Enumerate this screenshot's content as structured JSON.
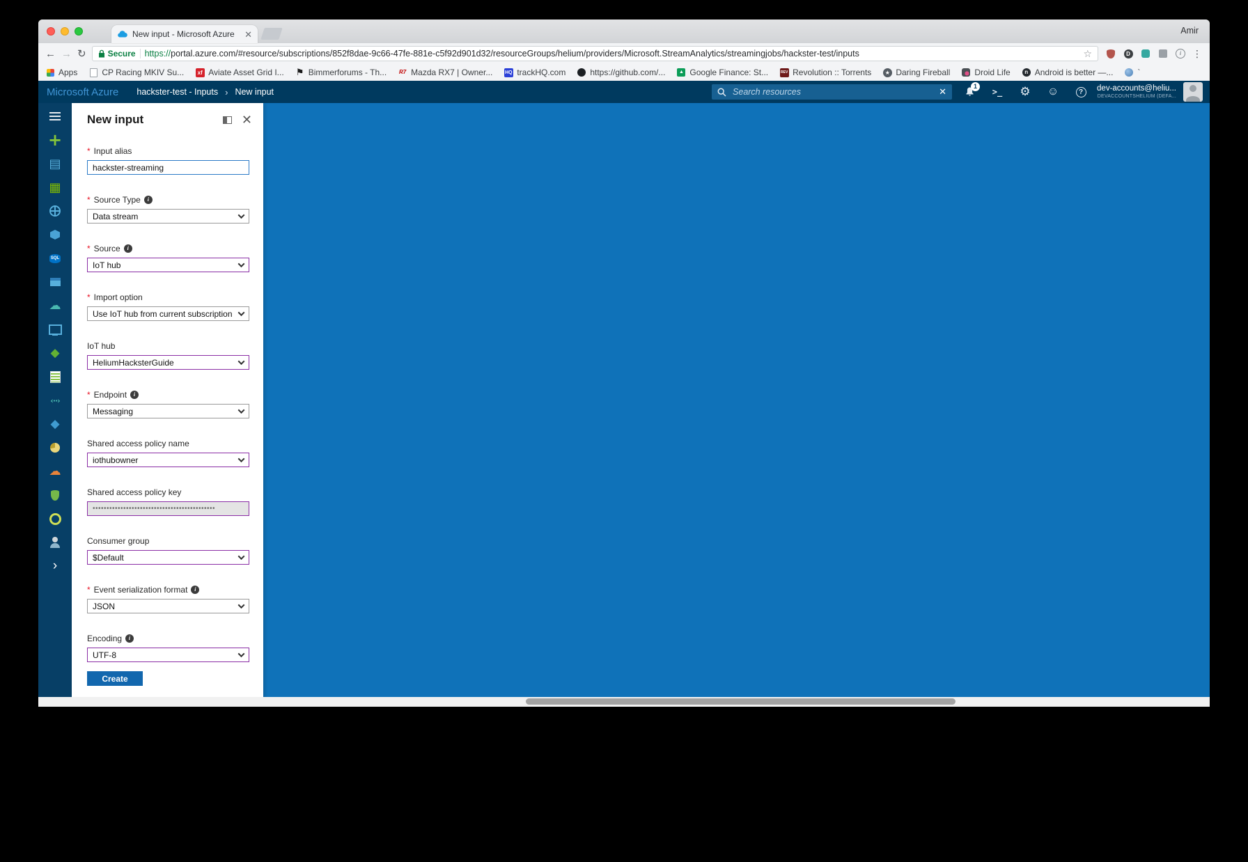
{
  "browser": {
    "profile_name": "Amir",
    "tab_title": "New input - Microsoft Azure",
    "address": {
      "security_label": "Secure",
      "url_scheme": "https://",
      "url_rest": "portal.azure.com/#resource/subscriptions/852f8dae-9c66-47fe-881e-c5f92d901d32/resourceGroups/helium/providers/Microsoft.StreamAnalytics/streamingjobs/hackster-test/inputs"
    },
    "extensions": [
      {
        "name": "extension-icon-1",
        "kind": "ext1"
      },
      {
        "name": "extension-icon-2",
        "kind": "ext2"
      },
      {
        "name": "extension-icon-3",
        "kind": "ext3"
      },
      {
        "name": "extension-icon-4",
        "kind": "ext4"
      },
      {
        "name": "extension-icon-5",
        "kind": "ext5"
      }
    ],
    "bookmarks": [
      {
        "name": "bookmark-apps",
        "kind": "apps",
        "label": "Apps"
      },
      {
        "name": "bookmark-cp-racing",
        "kind": "page",
        "label": "CP Racing MKIV Su..."
      },
      {
        "name": "bookmark-aviate",
        "kind": "xf",
        "label": "Aviate Asset Grid I..."
      },
      {
        "name": "bookmark-bimmerforums",
        "kind": "flag",
        "label": "Bimmerforums - Th..."
      },
      {
        "name": "bookmark-mazda-rx7",
        "kind": "rx7",
        "label": "Mazda RX7 | Owner..."
      },
      {
        "name": "bookmark-trackhq",
        "kind": "hq",
        "label": "trackHQ.com"
      },
      {
        "name": "bookmark-github",
        "kind": "github",
        "label": "https://github.com/..."
      },
      {
        "name": "bookmark-google-finance",
        "kind": "finance",
        "label": "Google Finance: St..."
      },
      {
        "name": "bookmark-revolution",
        "kind": "rev",
        "label": "Revolution :: Torrents"
      },
      {
        "name": "bookmark-daring-fireball",
        "kind": "star",
        "label": "Daring Fireball"
      },
      {
        "name": "bookmark-droid-life",
        "kind": "droid",
        "label": "Droid Life"
      },
      {
        "name": "bookmark-android-is-better",
        "kind": "dot",
        "label": "Android is better —..."
      },
      {
        "name": "bookmark-misc",
        "kind": "globe2",
        "label": "`"
      }
    ]
  },
  "azure": {
    "header": {
      "brand": "Microsoft Azure",
      "breadcrumb_primary": "hackster-test - Inputs",
      "breadcrumb_separator": "›",
      "breadcrumb_current": "New input",
      "search_placeholder": "Search resources",
      "notification_count": "1",
      "account": {
        "email": "dev-accounts@heliu...",
        "directory": "DEVACCOUNTSHELIUM (DEFA..."
      }
    },
    "sidebar": [
      {
        "item": "sidebar-item-menu",
        "icon": "hamburger-menu-icon",
        "kind": "hamburger"
      },
      {
        "item": "sidebar-item-new",
        "icon": "plus-icon",
        "kind": "plus"
      },
      {
        "item": "sidebar-item-dashboard",
        "icon": "dashboard-icon",
        "kind": "dashboard"
      },
      {
        "item": "sidebar-item-all-resources",
        "icon": "all-resources-grid-icon",
        "kind": "grid"
      },
      {
        "item": "sidebar-item-resource-groups",
        "icon": "globe-icon",
        "kind": "globe"
      },
      {
        "item": "sidebar-item-app-services",
        "icon": "cube-icon",
        "kind": "cube"
      },
      {
        "item": "sidebar-item-sql-databases",
        "icon": "sql-database-icon",
        "kind": "sql"
      },
      {
        "item": "sidebar-item-virtual-machines",
        "icon": "virtual-machine-icon",
        "kind": "vm"
      },
      {
        "item": "sidebar-item-cloud-services",
        "icon": "cloud-icon",
        "kind": "cloudteal"
      },
      {
        "item": "sidebar-item-monitor",
        "icon": "monitor-icon",
        "kind": "monitor"
      },
      {
        "item": "sidebar-item-subscriptions",
        "icon": "green-diamond-icon",
        "kind": "diamond-green"
      },
      {
        "item": "sidebar-item-templates",
        "icon": "list-icon",
        "kind": "list"
      },
      {
        "item": "sidebar-item-functions",
        "icon": "code-brackets-icon",
        "kind": "brackets"
      },
      {
        "item": "sidebar-item-stream-analytics",
        "icon": "blue-diamond-icon",
        "kind": "diamond-blue"
      },
      {
        "item": "sidebar-item-cost-management",
        "icon": "pie-icon",
        "kind": "pie"
      },
      {
        "item": "sidebar-item-help-support",
        "icon": "orange-cloud-icon",
        "kind": "cloud-orange"
      },
      {
        "item": "sidebar-item-security-center",
        "icon": "shield-icon",
        "kind": "shield"
      },
      {
        "item": "sidebar-item-advisor",
        "icon": "ring-icon",
        "kind": "ring"
      },
      {
        "item": "sidebar-item-active-directory",
        "icon": "person-icon",
        "kind": "person"
      },
      {
        "item": "sidebar-item-expand",
        "icon": "chevron-right-icon",
        "kind": "chevron"
      }
    ],
    "blade": {
      "title": "New input",
      "fields": [
        {
          "name": "input-alias-input",
          "label": "Input alias",
          "required": true,
          "info": false,
          "control": "text",
          "chevron": false,
          "value": "hackster-streaming",
          "border": "#2a7ac7",
          "disabled": false
        },
        {
          "name": "source-type-select",
          "label": "Source Type",
          "required": true,
          "info": true,
          "control": "select",
          "chevron": true,
          "value": "Data stream",
          "border": "#9a9a9a",
          "disabled": false
        },
        {
          "name": "source-select",
          "label": "Source",
          "required": true,
          "info": true,
          "control": "select",
          "chevron": true,
          "value": "IoT hub",
          "border": "#8a2da5",
          "disabled": false
        },
        {
          "name": "import-option-select",
          "label": "Import option",
          "required": true,
          "info": false,
          "control": "select",
          "chevron": true,
          "value": "Use IoT hub from current subscription",
          "border": "#9a9a9a",
          "disabled": false
        },
        {
          "name": "iot-hub-select",
          "label": "IoT hub",
          "required": false,
          "info": false,
          "control": "select",
          "chevron": true,
          "value": "HeliumHacksterGuide",
          "border": "#8a2da5",
          "disabled": false
        },
        {
          "name": "endpoint-select",
          "label": "Endpoint",
          "required": true,
          "info": true,
          "control": "select",
          "chevron": true,
          "value": "Messaging",
          "border": "#9a9a9a",
          "disabled": false
        },
        {
          "name": "shared-access-policy-name-select",
          "label": "Shared access policy name",
          "required": false,
          "info": false,
          "control": "select",
          "chevron": true,
          "value": "iothubowner",
          "border": "#8a2da5",
          "disabled": false
        },
        {
          "name": "shared-access-policy-key-input",
          "label": "Shared access policy key",
          "required": false,
          "info": false,
          "control": "password",
          "chevron": false,
          "value": "••••••••••••••••••••••••••••••••••••••••••••",
          "border": "#8a2da5",
          "disabled": true
        },
        {
          "name": "consumer-group-select",
          "label": "Consumer group",
          "required": false,
          "info": false,
          "control": "select",
          "chevron": true,
          "value": "$Default",
          "border": "#8a2da5",
          "disabled": false
        },
        {
          "name": "event-serialization-format-select",
          "label": "Event serialization format",
          "required": true,
          "info": true,
          "control": "select",
          "chevron": true,
          "value": "JSON",
          "border": "#9a9a9a",
          "disabled": false
        },
        {
          "name": "encoding-select",
          "label": "Encoding",
          "required": false,
          "info": true,
          "control": "select",
          "chevron": true,
          "value": "UTF-8",
          "border": "#8a2da5",
          "disabled": false
        }
      ],
      "create_label": "Create"
    },
    "colors": {
      "header_navy": "#003a5f",
      "sidebar_navy": "#073f66",
      "canvas_blue": "#0f72b9",
      "brand_blue": "#4095d5",
      "primary_button": "#1267ae",
      "required_red": "#e81123",
      "changed_field_purple": "#8a2da5",
      "secure_green": "#0b8043"
    }
  }
}
